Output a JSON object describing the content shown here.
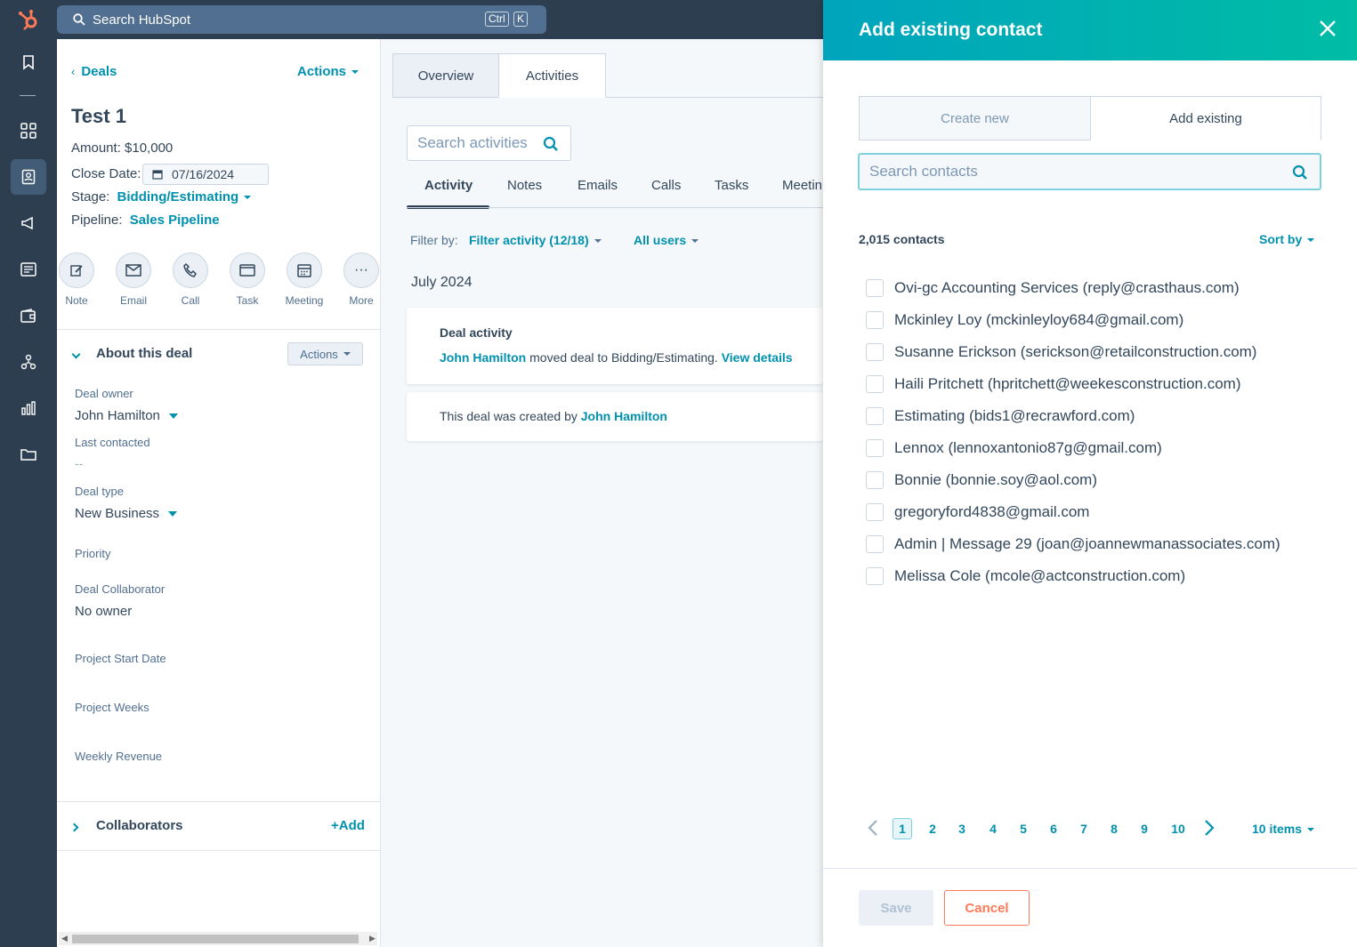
{
  "topbar": {
    "search_placeholder": "Search HubSpot",
    "shortcut_ctrl": "Ctrl",
    "shortcut_k": "K"
  },
  "left_panel": {
    "back_link": "Deals",
    "actions_label": "Actions",
    "deal_name": "Test 1",
    "amount": "Amount: $10,000",
    "close_date_label": "Close Date:",
    "close_date_value": "07/16/2024",
    "stage_label": "Stage:",
    "stage_value": "Bidding/Estimating",
    "pipeline_label": "Pipeline:",
    "pipeline_value": "Sales Pipeline",
    "action_buttons": [
      "Note",
      "Email",
      "Call",
      "Task",
      "Meeting",
      "More"
    ],
    "about_section": {
      "title": "About this deal",
      "actions_label": "Actions",
      "properties": [
        {
          "label": "Deal owner",
          "value": "John Hamilton"
        },
        {
          "label": "Last contacted",
          "value": "--"
        },
        {
          "label": "Deal type",
          "value": "New Business"
        },
        {
          "label": "Priority",
          "value": ""
        },
        {
          "label": "Deal Collaborator",
          "value": "No owner"
        },
        {
          "label": "Project Start Date",
          "value": ""
        },
        {
          "label": "Project Weeks",
          "value": ""
        },
        {
          "label": "Weekly Revenue",
          "value": ""
        }
      ]
    },
    "collaborators": {
      "title": "Collaborators",
      "add_label": "+Add"
    }
  },
  "middle": {
    "tabs": [
      "Overview",
      "Activities"
    ],
    "active_tab": "Activities",
    "search_placeholder": "Search activities",
    "subtabs": [
      "Activity",
      "Notes",
      "Emails",
      "Calls",
      "Tasks",
      "Meetin"
    ],
    "filter_label": "Filter by:",
    "filter_activity": "Filter activity (12/18)",
    "filter_users": "All users",
    "month": "July 2024",
    "card1": {
      "title": "Deal activity",
      "actor": "John Hamilton",
      "text": "moved deal to Bidding/Estimating.",
      "link": "View details"
    },
    "card2": {
      "text": "This deal was created by",
      "actor": "John Hamilton"
    }
  },
  "modal": {
    "title": "Add existing contact",
    "tabs": [
      "Create new",
      "Add existing"
    ],
    "active_tab": "Add existing",
    "search_placeholder": "Search contacts",
    "count": "2,015 contacts",
    "sort_label": "Sort by",
    "contacts": [
      "Ovi-gc Accounting Services (reply@crasthaus.com)",
      "Mckinley Loy (mckinleyloy684@gmail.com)",
      "Susanne Erickson (serickson@retailconstruction.com)",
      "Haili Pritchett (hpritchett@weekesconstruction.com)",
      "Estimating (bids1@recrawford.com)",
      "Lennox (lennoxantonio87g@gmail.com)",
      "Bonnie (bonnie.soy@aol.com)",
      "gregoryford4838@gmail.com",
      "Admin | Message 29 (joan@joannewmanassociates.com)",
      "Melissa Cole (mcole@actconstruction.com)"
    ],
    "pages": [
      "1",
      "2",
      "3",
      "4",
      "5",
      "6",
      "7",
      "8",
      "9",
      "10"
    ],
    "current_page": "1",
    "items_per_page": "10 items",
    "save_label": "Save",
    "cancel_label": "Cancel"
  },
  "colors": {
    "nav_bg": "#2d3e50",
    "accent": "#0091ae",
    "header_gradient_start": "#00a4bd",
    "header_gradient_end": "#00bda5",
    "cancel": "#ff7a59",
    "logo": "#ff7a59"
  }
}
